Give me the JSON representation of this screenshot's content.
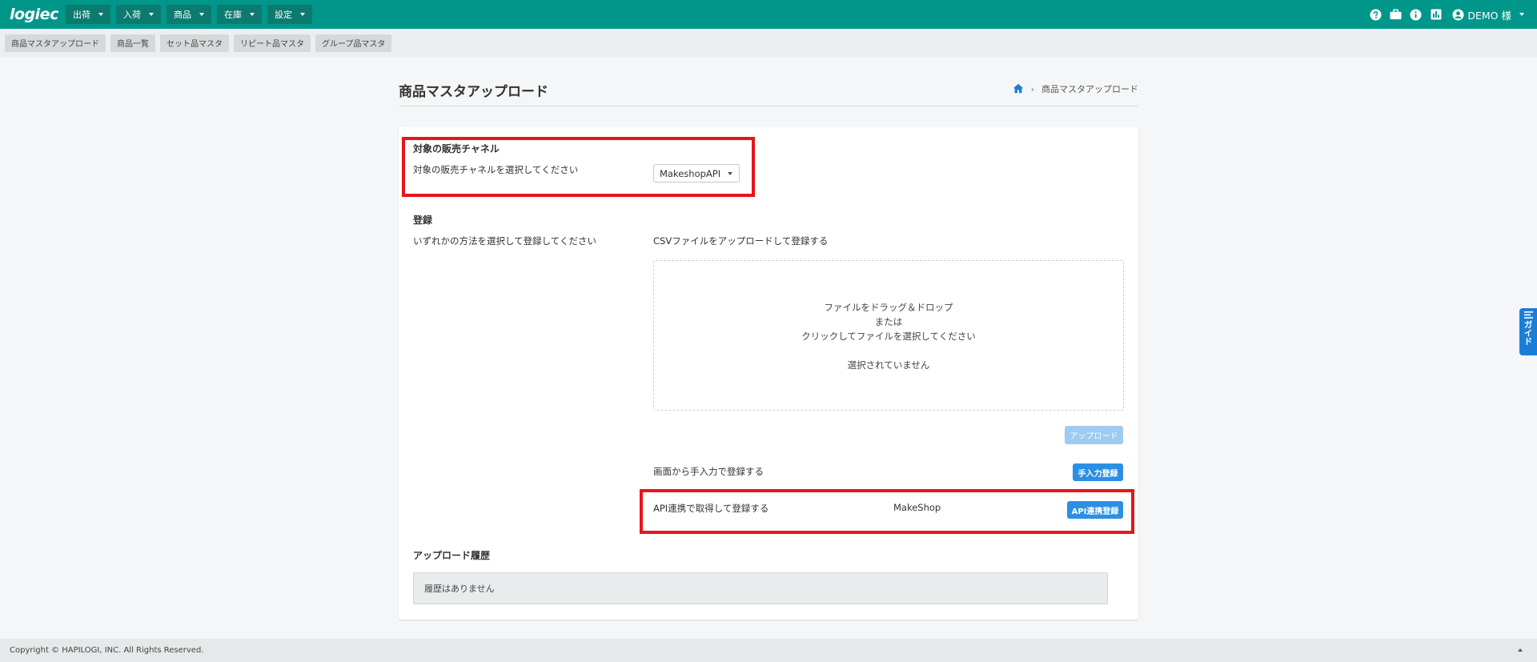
{
  "app": {
    "logo_text": "logiec"
  },
  "nav": {
    "menus": [
      {
        "label": "出荷"
      },
      {
        "label": "入荷"
      },
      {
        "label": "商品"
      },
      {
        "label": "在庫"
      },
      {
        "label": "設定"
      }
    ],
    "user_label": "DEMO 様",
    "icons": [
      "help-icon",
      "briefcase-icon",
      "info-icon",
      "chart-icon",
      "account-icon"
    ]
  },
  "subnav": {
    "tabs": [
      {
        "label": "商品マスタアップロード"
      },
      {
        "label": "商品一覧"
      },
      {
        "label": "セット品マスタ"
      },
      {
        "label": "リピート品マスタ"
      },
      {
        "label": "グループ品マスタ"
      }
    ]
  },
  "page": {
    "title": "商品マスタアップロード",
    "breadcrumb_current": "商品マスタアップロード",
    "breadcrumb_separator": "›"
  },
  "channel": {
    "section_title": "対象の販売チャネル",
    "instruction": "対象の販売チャネルを選択してください",
    "selected": "MakeshopAPI"
  },
  "register": {
    "section_title": "登録",
    "instruction": "いずれかの方法を選択して登録してください",
    "csv_label": "CSVファイルをアップロードして登録する",
    "dropzone": {
      "line1": "ファイルをドラッグ＆ドロップ",
      "line2": "または",
      "line3": "クリックしてファイルを選択してください",
      "status": "選択されていません"
    },
    "upload_button": "アップロード",
    "manual_label": "画面から手入力で登録する",
    "manual_button": "手入力登録",
    "api_label": "API連携で取得して登録する",
    "api_shop": "MakeShop",
    "api_button": "API連携登録"
  },
  "history": {
    "section_title": "アップロード履歴",
    "empty_text": "履歴はありません"
  },
  "guide": {
    "label": "ガイド"
  },
  "footer": {
    "copyright": "Copyright © HAPILOGI, INC. All Rights Reserved."
  },
  "colors": {
    "header": "#00968a",
    "primary_button": "#2b8fe4",
    "highlight_box": "#e8141b"
  }
}
